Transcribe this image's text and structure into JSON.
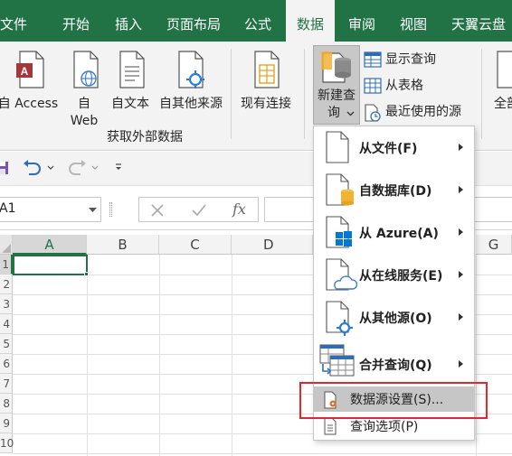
{
  "tabs": [
    "文件",
    "开始",
    "插入",
    "页面布局",
    "公式",
    "数据",
    "审阅",
    "视图",
    "天翼云盘"
  ],
  "active_tab": "数据",
  "ribbon": {
    "get_external": {
      "access_label": "自 Access",
      "web_line1": "自",
      "web_line2": "Web",
      "text_label": "自文本",
      "other_label": "自其他来源",
      "group_label": "获取外部数据"
    },
    "existing_label": "现有连接",
    "new_query_line1": "新建查",
    "new_query_line2": "询",
    "show_queries": "显示查询",
    "from_table": "从表格",
    "recent_sources": "最近使用的源",
    "refresh_all": "全部"
  },
  "formula_bar": {
    "name_box": "A1",
    "fx": "fx"
  },
  "grid": {
    "columns": [
      "A",
      "B",
      "C",
      "D",
      "G"
    ],
    "rows": [
      "1",
      "2",
      "3",
      "4",
      "5",
      "6",
      "7",
      "8",
      "9",
      "10"
    ]
  },
  "menu": {
    "items": [
      {
        "label": "从文件(F)",
        "icon": "file-icon"
      },
      {
        "label": "自数据库(D)",
        "icon": "database-icon"
      },
      {
        "label": "从 Azure(A)",
        "icon": "azure-icon"
      },
      {
        "label": "从在线服务(E)",
        "icon": "cloud-icon"
      },
      {
        "label": "从其他源(O)",
        "icon": "other-source-icon"
      },
      {
        "label": "合并查询(Q)",
        "icon": "merge-icon"
      }
    ],
    "data_source_settings": "数据源设置(S)...",
    "query_options": "查询选项(P)"
  },
  "colors": {
    "excel_green": "#217346",
    "highlight_red": "#e0282e"
  }
}
